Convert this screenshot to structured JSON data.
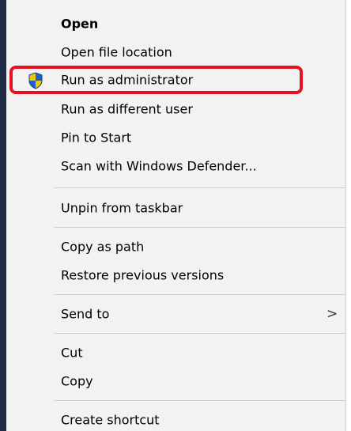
{
  "context_menu": {
    "items": [
      {
        "id": "open",
        "label": "Open",
        "bold": true
      },
      {
        "id": "open-file-location",
        "label": "Open file location"
      },
      {
        "id": "run-as-administrator",
        "label": "Run as administrator",
        "icon": "uac-shield-icon"
      },
      {
        "id": "run-as-different-user",
        "label": "Run as different user"
      },
      {
        "id": "pin-to-start",
        "label": "Pin to Start"
      },
      {
        "id": "scan-with-windows-defender",
        "label": "Scan with Windows Defender..."
      },
      {
        "id": "unpin-from-taskbar",
        "label": "Unpin from taskbar"
      },
      {
        "id": "copy-as-path",
        "label": "Copy as path"
      },
      {
        "id": "restore-previous-versions",
        "label": "Restore previous versions"
      },
      {
        "id": "send-to",
        "label": "Send to",
        "submenu_arrow": ">"
      },
      {
        "id": "cut",
        "label": "Cut"
      },
      {
        "id": "copy",
        "label": "Copy"
      },
      {
        "id": "create-shortcut",
        "label": "Create shortcut"
      }
    ],
    "highlighted_item": "Run as administrator"
  },
  "colors": {
    "menu_background": "#f2f2f2",
    "highlight_border": "#e81123",
    "shield_blue": "#1a63c9",
    "shield_yellow": "#f5c400"
  }
}
